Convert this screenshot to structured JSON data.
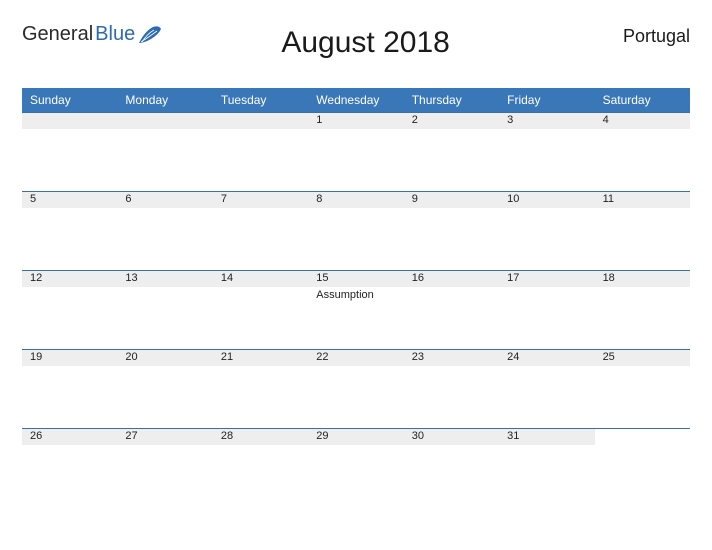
{
  "logo": {
    "part1": "General",
    "part2": "Blue"
  },
  "title": "August 2018",
  "region": "Portugal",
  "dayNames": [
    "Sunday",
    "Monday",
    "Tuesday",
    "Wednesday",
    "Thursday",
    "Friday",
    "Saturday"
  ],
  "weeks": [
    [
      {
        "n": "",
        "note": ""
      },
      {
        "n": "",
        "note": ""
      },
      {
        "n": "",
        "note": ""
      },
      {
        "n": "1",
        "note": ""
      },
      {
        "n": "2",
        "note": ""
      },
      {
        "n": "3",
        "note": ""
      },
      {
        "n": "4",
        "note": ""
      }
    ],
    [
      {
        "n": "5",
        "note": ""
      },
      {
        "n": "6",
        "note": ""
      },
      {
        "n": "7",
        "note": ""
      },
      {
        "n": "8",
        "note": ""
      },
      {
        "n": "9",
        "note": ""
      },
      {
        "n": "10",
        "note": ""
      },
      {
        "n": "11",
        "note": ""
      }
    ],
    [
      {
        "n": "12",
        "note": ""
      },
      {
        "n": "13",
        "note": ""
      },
      {
        "n": "14",
        "note": ""
      },
      {
        "n": "15",
        "note": "Assumption"
      },
      {
        "n": "16",
        "note": ""
      },
      {
        "n": "17",
        "note": ""
      },
      {
        "n": "18",
        "note": ""
      }
    ],
    [
      {
        "n": "19",
        "note": ""
      },
      {
        "n": "20",
        "note": ""
      },
      {
        "n": "21",
        "note": ""
      },
      {
        "n": "22",
        "note": ""
      },
      {
        "n": "23",
        "note": ""
      },
      {
        "n": "24",
        "note": ""
      },
      {
        "n": "25",
        "note": ""
      }
    ],
    [
      {
        "n": "26",
        "note": ""
      },
      {
        "n": "27",
        "note": ""
      },
      {
        "n": "28",
        "note": ""
      },
      {
        "n": "29",
        "note": ""
      },
      {
        "n": "30",
        "note": ""
      },
      {
        "n": "31",
        "note": ""
      },
      {
        "n": "",
        "note": "",
        "blank": true
      }
    ]
  ]
}
